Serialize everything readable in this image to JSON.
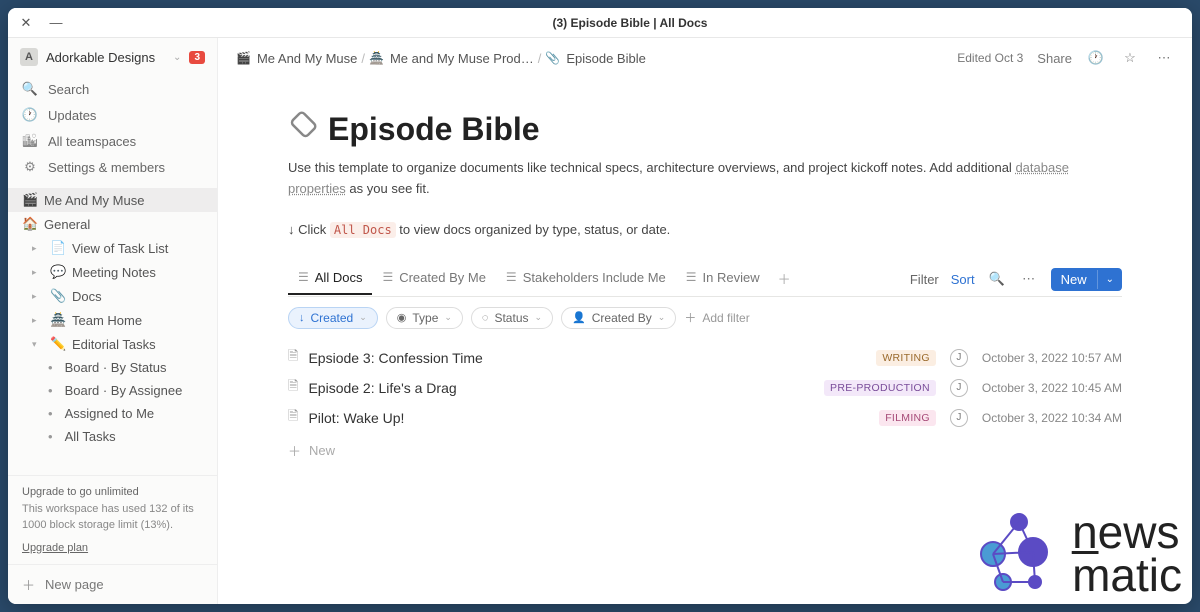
{
  "window": {
    "title": "(3) Episode Bible | All Docs"
  },
  "sidebar": {
    "workspace": {
      "initial": "A",
      "name": "Adorkable Designs",
      "notif_count": "3"
    },
    "nav": [
      {
        "icon": "🔍",
        "label": "Search",
        "name": "search"
      },
      {
        "icon": "🕐",
        "label": "Updates",
        "name": "updates"
      },
      {
        "icon": "🏙",
        "label": "All teamspaces",
        "name": "all-teamspaces"
      },
      {
        "icon": "⚙",
        "label": "Settings & members",
        "name": "settings"
      }
    ],
    "teamspaces": [
      {
        "emoji": "🎬",
        "label": "Me And My Muse",
        "active": true
      },
      {
        "emoji": "🏠",
        "label": "General"
      }
    ],
    "pages": [
      {
        "emoji": "📄",
        "label": "View of Task List",
        "indent": 1
      },
      {
        "emoji": "💬",
        "label": "Meeting Notes",
        "indent": 1
      },
      {
        "emoji": "📎",
        "label": "Docs",
        "indent": 1
      },
      {
        "emoji": "🏯",
        "label": "Team Home",
        "indent": 1
      },
      {
        "emoji": "✏️",
        "label": "Editorial Tasks",
        "indent": 1,
        "expanded": true
      },
      {
        "label": "Board · By Status",
        "indent": 2
      },
      {
        "label": "Board · By Assignee",
        "indent": 2
      },
      {
        "label": "Assigned to Me",
        "indent": 2
      },
      {
        "label": "All Tasks",
        "indent": 2
      }
    ],
    "upgrade": {
      "title": "Upgrade to go unlimited",
      "text": "This workspace has used 132 of its 1000 block storage limit (13%).",
      "link": "Upgrade plan"
    },
    "new_page": "New page"
  },
  "breadcrumbs": [
    {
      "emoji": "🎬",
      "label": "Me And My Muse"
    },
    {
      "emoji": "🏯",
      "label": "Me and My Muse Prod…"
    },
    {
      "emoji": "📎",
      "label": "Episode Bible"
    }
  ],
  "topbar": {
    "edited": "Edited Oct 3",
    "share": "Share"
  },
  "page": {
    "icon": "📎",
    "title": "Episode Bible",
    "desc_1": "Use this template to organize documents like technical specs, architecture overviews, and project kickoff notes. Add additional ",
    "desc_link": "database properties",
    "desc_2": " as you see fit.",
    "hint_prefix": "↓ Click ",
    "hint_code": "All Docs",
    "hint_suffix": " to view docs organized by type, status, or date."
  },
  "tabs": [
    {
      "label": "All Docs",
      "active": true
    },
    {
      "label": "Created By Me"
    },
    {
      "label": "Stakeholders Include Me"
    },
    {
      "label": "In Review"
    }
  ],
  "db_toolbar": {
    "filter": "Filter",
    "sort": "Sort",
    "new": "New"
  },
  "filters": [
    {
      "label": "Created",
      "active": true,
      "icon": "↓"
    },
    {
      "label": "Type",
      "icon": "◉"
    },
    {
      "label": "Status",
      "icon": "◌"
    },
    {
      "label": "Created By",
      "icon": "👤"
    }
  ],
  "add_filter": "Add filter",
  "docs": [
    {
      "title": "Epsiode 3: Confession Time",
      "status": "WRITING",
      "status_bg": "#fbeee2",
      "status_fg": "#9a6a2c",
      "author": "J",
      "date": "October 3, 2022 10:57 AM"
    },
    {
      "title": "Episode 2: Life's a Drag",
      "status": "PRE-PRODUCTION",
      "status_bg": "#f3e8f9",
      "status_fg": "#7a4d9a",
      "author": "J",
      "date": "October 3, 2022 10:45 AM"
    },
    {
      "title": "Pilot: Wake Up!",
      "status": "FILMING",
      "status_bg": "#fbe6ef",
      "status_fg": "#a64a77",
      "author": "J",
      "date": "October 3, 2022 10:34 AM"
    }
  ],
  "add_row": "New",
  "watermark": {
    "line1": "n̲ews",
    "line2": "matic"
  }
}
